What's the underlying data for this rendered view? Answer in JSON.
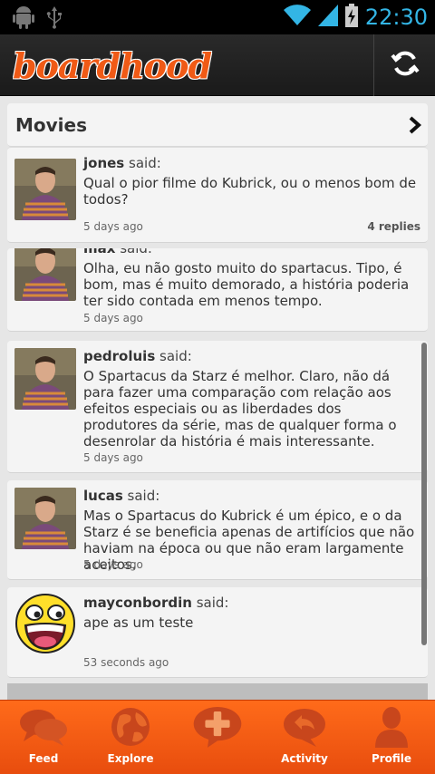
{
  "statusbar": {
    "time": "22:30",
    "icons": [
      "android-icon",
      "usb-icon",
      "wifi-icon",
      "signal-icon",
      "battery-charging-icon"
    ]
  },
  "app": {
    "logo_text": "boardhood",
    "accent": "#f05a16"
  },
  "header": {
    "title": "Movies"
  },
  "posts": [
    {
      "username": "jones",
      "said": "said:",
      "message": "Qual o pior filme do Kubrick, ou o menos bom de todos?",
      "ago": "5 days ago",
      "replies": "4 replies"
    },
    {
      "username": "max",
      "said": "said:",
      "message": "Olha, eu não gosto muito do spartacus. Tipo, é bom, mas é muito demorado, a história poderia ter sido contada em menos tempo.",
      "ago": "5 days ago"
    },
    {
      "username": "pedroluis",
      "said": "said:",
      "message": "O Spartacus da Starz é melhor. Claro, não dá para fazer uma comparação com relação aos efeitos especiais ou as liberdades dos produtores da série, mas de qualquer forma o desenrolar da história é mais interessante.",
      "ago": "5 days ago"
    },
    {
      "username": "lucas",
      "said": "said:",
      "message": "Mas o Spartacus do Kubrick é um épico, e o da Starz é se beneficia apenas de artifícios que não haviam na época ou que não eram largamente aceitos.",
      "ago": "5 days ago"
    },
    {
      "username": "mayconbordin",
      "said": "said:",
      "message": "ape as um teste",
      "ago": "53 seconds ago"
    }
  ],
  "nav": [
    {
      "label": "Feed",
      "icon": "chat-bubbles-icon"
    },
    {
      "label": "Explore",
      "icon": "globe-icon"
    },
    {
      "label": "",
      "icon": "add-post-icon"
    },
    {
      "label": "Activity",
      "icon": "reply-bubble-icon"
    },
    {
      "label": "Profile",
      "icon": "person-icon"
    }
  ]
}
